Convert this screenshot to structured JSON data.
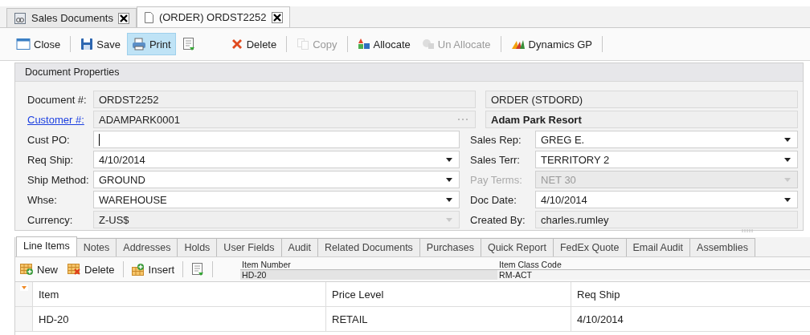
{
  "doc_tabs": [
    {
      "label": "Sales Documents",
      "kind": "list",
      "selected": false
    },
    {
      "label": "(ORDER) ORDST2252",
      "kind": "page",
      "selected": true
    }
  ],
  "toolbar": [
    [
      {
        "kind": "close",
        "label": "Close",
        "disabled": false,
        "highlighted": false
      }
    ],
    [
      {
        "kind": "save",
        "label": "Save",
        "disabled": false,
        "highlighted": false
      },
      {
        "kind": "print",
        "label": "Print",
        "disabled": false,
        "highlighted": true
      },
      {
        "kind": "layout",
        "disabled": false,
        "highlighted": false
      },
      {
        "kind": "delete",
        "label": "Delete",
        "disabled": false,
        "highlighted": false
      }
    ],
    [
      {
        "kind": "copy",
        "label": "Copy",
        "disabled": true,
        "highlighted": false
      }
    ],
    [
      {
        "kind": "allocate",
        "label": "Allocate",
        "disabled": false,
        "highlighted": false
      },
      {
        "kind": "unallocate",
        "label": "Un Allocate",
        "disabled": true,
        "highlighted": false
      }
    ],
    [
      {
        "kind": "chart",
        "label": "Dynamics GP",
        "disabled": false,
        "highlighted": false
      }
    ]
  ],
  "panel_title": "Document Properties",
  "header_rows": [
    {
      "label": "Document #:",
      "link": false,
      "value": "ORDST2252",
      "lookup": false,
      "info": "ORDER (STDORD)",
      "info_bold": false
    },
    {
      "label": "Customer #:",
      "link": true,
      "value": "ADAMPARK0001",
      "lookup": true,
      "info": "Adam Park Resort",
      "info_bold": true
    }
  ],
  "rows": [
    {
      "left": {
        "label": "Cust PO:",
        "kind": "text",
        "focused": true,
        "disabled": false
      },
      "right": {
        "label": "Sales Rep:",
        "kind": "dropdown",
        "value": "GREG E.",
        "disabled": false
      }
    },
    {
      "left": {
        "label": "Req Ship:",
        "kind": "dropdown",
        "value": "4/10/2014",
        "disabled": false
      },
      "right": {
        "label": "Sales Terr:",
        "kind": "dropdown",
        "value": "TERRITORY 2",
        "disabled": false
      }
    },
    {
      "left": {
        "label": "Ship Method:",
        "kind": "dropdown",
        "value": "GROUND",
        "disabled": false
      },
      "right": {
        "label": "Pay Terms:",
        "kind": "dropdown",
        "value": "NET 30",
        "disabled": true
      }
    },
    {
      "left": {
        "label": "Whse:",
        "kind": "dropdown",
        "value": "WAREHOUSE",
        "disabled": false
      },
      "right": {
        "label": "Doc Date:",
        "kind": "dropdown",
        "value": "4/10/2014",
        "disabled": false
      }
    },
    {
      "left": {
        "label": "Currency:",
        "kind": "locked",
        "value": "Z-US$",
        "disabled": false
      },
      "right": {
        "label": "Created By:",
        "kind": "readonly",
        "value": "charles.rumley",
        "disabled": false
      }
    }
  ],
  "detail_tabs": [
    {
      "label": "Line Items",
      "selected": true
    },
    {
      "label": "Notes",
      "selected": false
    },
    {
      "label": "Addresses",
      "selected": false
    },
    {
      "label": "Holds",
      "selected": false
    },
    {
      "label": "User Fields",
      "selected": false
    },
    {
      "label": "Audit",
      "selected": false
    },
    {
      "label": "Related Documents",
      "selected": false
    },
    {
      "label": "Purchases",
      "selected": false
    },
    {
      "label": "Quick Report",
      "selected": false
    },
    {
      "label": "FedEx Quote",
      "selected": false
    },
    {
      "label": "Email Audit",
      "selected": false
    },
    {
      "label": "Assemblies",
      "selected": false
    }
  ],
  "line_toolbar": [
    [
      {
        "kind": "new",
        "label": "New"
      },
      {
        "kind": "delete",
        "label": "Delete"
      }
    ],
    [
      {
        "kind": "insert",
        "label": "Insert"
      }
    ],
    [
      {
        "kind": "layout"
      }
    ]
  ],
  "item_info": [
    {
      "label": "Item Number",
      "value": "HD-20"
    },
    {
      "label": "Item Class Code",
      "value": "RM-ACT"
    }
  ],
  "grid": {
    "columns": [
      "Item",
      "Price Level",
      "Req Ship"
    ],
    "rows": [
      [
        "HD-20",
        "RETAIL",
        "4/10/2014"
      ]
    ]
  }
}
